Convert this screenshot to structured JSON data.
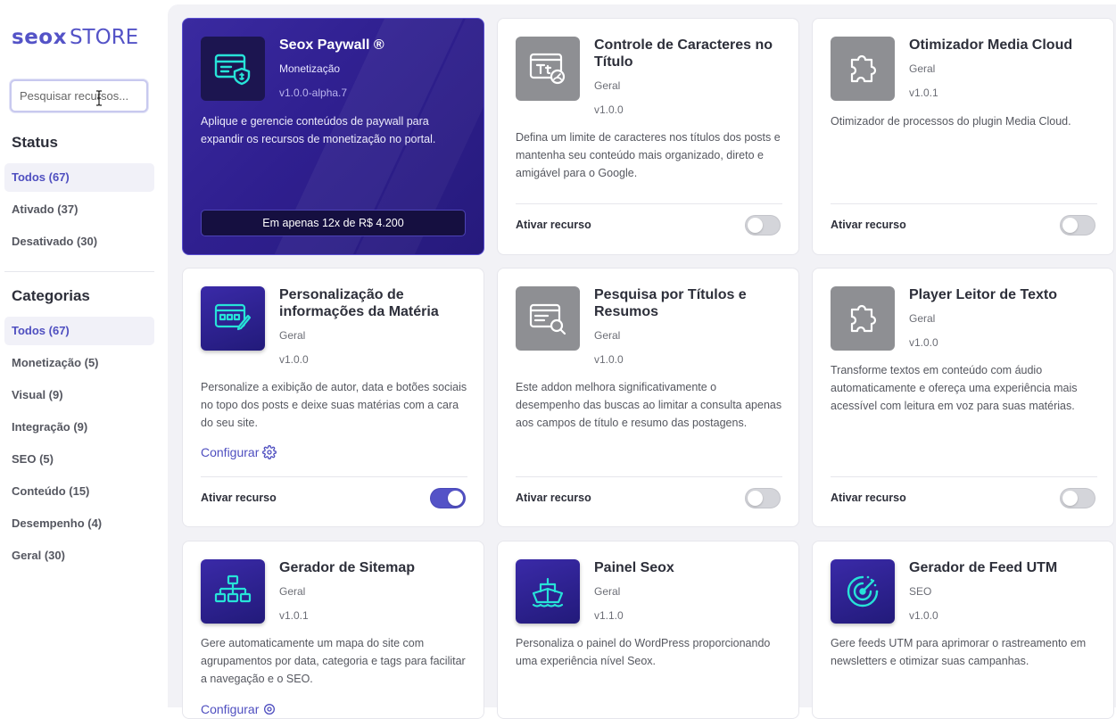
{
  "brand": {
    "part1": "seox",
    "part2": "STORE"
  },
  "search": {
    "placeholder": "Pesquisar recursos..."
  },
  "status": {
    "title": "Status",
    "items": [
      {
        "label": "Todos (67)",
        "active": true
      },
      {
        "label": "Ativado (37)"
      },
      {
        "label": "Desativado (30)"
      }
    ]
  },
  "categories": {
    "title": "Categorias",
    "items": [
      {
        "label": "Todos (67)",
        "active": true
      },
      {
        "label": "Monetização (5)"
      },
      {
        "label": "Visual (9)"
      },
      {
        "label": "Integração (9)"
      },
      {
        "label": "SEO (5)"
      },
      {
        "label": "Conteúdo (15)"
      },
      {
        "label": "Desempenho (4)"
      },
      {
        "label": "Geral (30)"
      }
    ]
  },
  "cards": [
    {
      "title": "Seox Paywall ®",
      "category": "Monetização",
      "version": "v1.0.0-alpha.7",
      "description": "Aplique e gerencie conteúdos de paywall para expandir os recursos de monetização no portal.",
      "price": "Em apenas 12x de R$ 4.200",
      "icon": "paywall-icon"
    },
    {
      "title": "Controle de Caracteres no Título",
      "category": "Geral",
      "version": "v1.0.0",
      "description": "Defina um limite de caracteres nos títulos dos posts e mantenha seu conteúdo mais organizado, direto e amigável para o Google.",
      "activate_label": "Ativar recurso",
      "enabled": false,
      "icon": "title-counter-icon"
    },
    {
      "title": "Otimizador Media Cloud",
      "category": "Geral",
      "version": "v1.0.1",
      "description": "Otimizador de processos do plugin Media Cloud.",
      "activate_label": "Ativar recurso",
      "enabled": false,
      "icon": "puzzle-icon"
    },
    {
      "title": "Personalização de informações da Matéria",
      "category": "Geral",
      "version": "v1.0.0",
      "description": "Personalize a exibição de autor, data e botões sociais no topo dos posts e deixe suas matérias com a cara do seu site.",
      "configure_label": "Configurar",
      "activate_label": "Ativar recurso",
      "enabled": true,
      "icon": "layout-brush-icon"
    },
    {
      "title": "Pesquisa por Títulos e Resumos",
      "category": "Geral",
      "version": "v1.0.0",
      "description": "Este addon melhora significativamente o desempenho das buscas ao limitar a consulta apenas aos campos de título e resumo das postagens.",
      "activate_label": "Ativar recurso",
      "enabled": false,
      "icon": "search-doc-icon"
    },
    {
      "title": "Player Leitor de Texto",
      "category": "Geral",
      "version": "v1.0.0",
      "description": "Transforme textos em conteúdo com áudio automaticamente e ofereça uma experiência mais acessível com leitura em voz para suas matérias.",
      "activate_label": "Ativar recurso",
      "enabled": false,
      "icon": "puzzle-icon"
    },
    {
      "title": "Gerador de Sitemap",
      "category": "Geral",
      "version": "v1.0.1",
      "description": "Gere automaticamente um mapa do site com agrupamentos por data, categoria e tags para facilitar a navegação e o SEO.",
      "configure_label": "Configurar",
      "icon": "sitemap-icon"
    },
    {
      "title": "Painel Seox",
      "category": "Geral",
      "version": "v1.1.0",
      "description": "Personaliza o painel do WordPress proporcionando uma experiência nível Seox.",
      "icon": "ship-icon"
    },
    {
      "title": "Gerador de Feed UTM",
      "category": "SEO",
      "version": "v1.0.0",
      "description": "Gere feeds UTM para aprimorar o rastreamento em newsletters e otimizar suas campanhas.",
      "icon": "target-icon"
    }
  ],
  "colors": {
    "accent": "#5453c7",
    "icon_cyan": "#27e3d8",
    "featured_bg": "#2f1f8f"
  }
}
